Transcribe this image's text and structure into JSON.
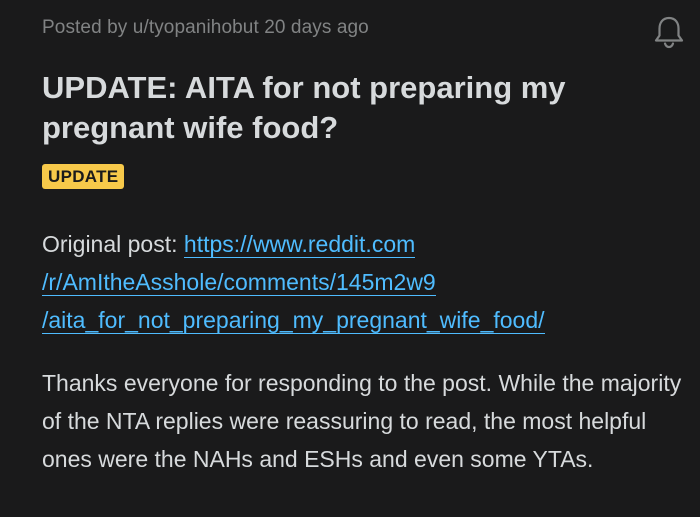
{
  "post": {
    "posted_by_prefix": "Posted by ",
    "author": "u/tyopanihobut",
    "age": " 20 days ago",
    "title": "UPDATE: AITA for not preparing my pregnant wife food?",
    "flair": "UPDATE",
    "original_label": "Original post: ",
    "link_lines": [
      "https://www.reddit.com",
      "/r/AmItheAsshole/comments/145m2w9",
      "/aita_for_not_preparing_my_pregnant_wife_food/"
    ],
    "body_paragraph": "Thanks everyone for responding to the post. While the majority of the NTA replies were reassuring to read, the most helpful ones were the NAHs and ESHs and even some YTAs."
  },
  "icons": {
    "notify": "bell-icon"
  },
  "colors": {
    "background": "#1a1a1b",
    "text": "#d7dadc",
    "meta": "#818384",
    "link": "#4fbcff",
    "flair_bg": "#f7c94a"
  }
}
